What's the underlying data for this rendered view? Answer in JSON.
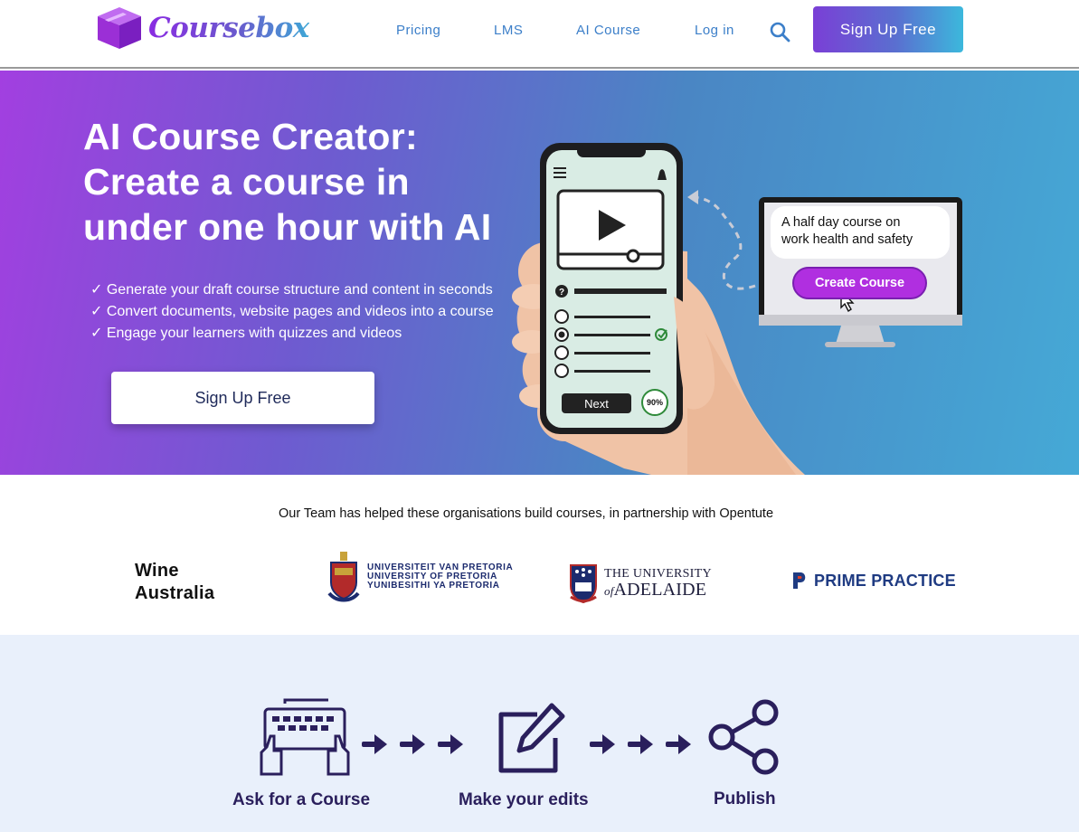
{
  "nav": {
    "brand": "Coursebox",
    "links": [
      "Pricing",
      "LMS",
      "AI Course",
      "Log in"
    ],
    "search_icon": "search-icon",
    "cta": "Sign Up Free"
  },
  "hero": {
    "title_lines": [
      "AI Course Creator:",
      "Create a course in",
      "under one hour with AI"
    ],
    "bullets": [
      "✓ Generate your draft course structure and content in seconds",
      "✓ Convert documents, website pages and videos into a course",
      "✓ Engage your learners with quizzes and videos"
    ],
    "cta": "Sign Up Free",
    "illustration": {
      "bubble_lines": [
        "A half day course on",
        "work health and safety"
      ],
      "create_button": "Create Course",
      "next_button": "Next",
      "progress": "90%"
    }
  },
  "partners": {
    "title": "Our Team has helped these organisations build courses, in partnership with Opentute",
    "wine_lines": [
      "Wine",
      "Australia"
    ],
    "pretoria_lines": [
      "UNIVERSITEIT VAN PRETORIA",
      "UNIVERSITY OF PRETORIA",
      "YUNIBESITHI YA PRETORIA"
    ],
    "adelaide_line1": "THE UNIVERSITY",
    "adelaide_of": "of",
    "adelaide_line2": "ADELAIDE",
    "prime": "PRIME PRACTICE"
  },
  "steps": {
    "labels": [
      "Ask for a Course",
      "Make your edits",
      "Publish"
    ]
  },
  "colors": {
    "brand_purple": "#8a2be2",
    "brand_blue": "#3fa7d6",
    "nav_link": "#3c7fc9",
    "step_text": "#2a1f5c"
  }
}
